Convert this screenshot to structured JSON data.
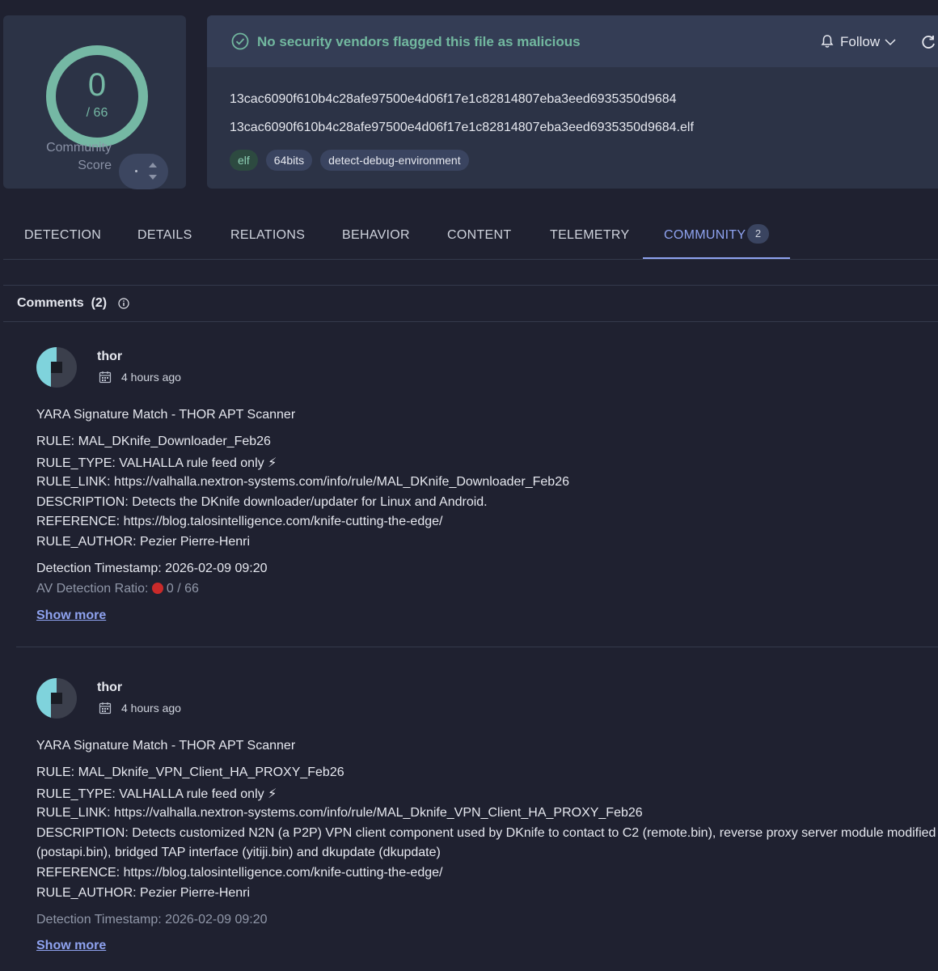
{
  "score": {
    "detections": "0",
    "total": "/ 66",
    "community_label_line1": "Community",
    "community_label_line2": "Score",
    "ring_color": "#75b8a4"
  },
  "header": {
    "status_text": "No security vendors flagged this file as malicious",
    "follow_label": "Follow",
    "hash": "13cac6090f610b4c28afe97500e4d06f17e1c82814807eba3eed6935350d9684",
    "filename": "13cac6090f610b4c28afe97500e4d06f17e1c82814807eba3eed6935350d9684.elf",
    "tags": [
      "elf",
      "64bits",
      "detect-debug-environment"
    ],
    "status_color": "#72b89f"
  },
  "tabs": [
    {
      "label": "DETECTION"
    },
    {
      "label": "DETAILS"
    },
    {
      "label": "RELATIONS"
    },
    {
      "label": "BEHAVIOR"
    },
    {
      "label": "CONTENT"
    },
    {
      "label": "TELEMETRY"
    },
    {
      "label": "COMMUNITY",
      "badge": "2",
      "active": true
    }
  ],
  "comments_section": {
    "title": "Comments  (2)"
  },
  "comments": [
    {
      "author": "thor",
      "time": "4 hours ago",
      "heading": "YARA Signature Match - THOR APT Scanner",
      "rule": "RULE: MAL_DKnife_Downloader_Feb26",
      "rule_type": "RULE_TYPE: VALHALLA rule feed only ⚡",
      "rule_link": "RULE_LINK: https://valhalla.nextron-systems.com/info/rule/MAL_DKnife_Downloader_Feb26",
      "description": "DESCRIPTION: Detects the DKnife downloader/updater for Linux and Android.",
      "reference": "REFERENCE: https://blog.talosintelligence.com/knife-cutting-the-edge/",
      "author_line": "RULE_AUTHOR: Pezier Pierre-Henri",
      "timestamp": "Detection Timestamp: 2026-02-09 09:20",
      "ratio_label": "AV Detection Ratio:",
      "ratio_value": "0 / 66",
      "show_more": "Show more"
    },
    {
      "author": "thor",
      "time": "4 hours ago",
      "heading": "YARA Signature Match - THOR APT Scanner",
      "rule": "RULE: MAL_Dknife_VPN_Client_HA_PROXY_Feb26",
      "rule_type": "RULE_TYPE: VALHALLA rule feed only ⚡",
      "rule_link": "RULE_LINK: https://valhalla.nextron-systems.com/info/rule/MAL_Dknife_VPN_Client_HA_PROXY_Feb26",
      "description": "DESCRIPTION: Detects customized N2N (a P2P) VPN client component used by DKnife to contact to C2 (remote.bin), reverse proxy server module modified",
      "description_cont": "(postapi.bin), bridged TAP interface (yitiji.bin) and dkupdate (dkupdate)",
      "reference": "REFERENCE: https://blog.talosintelligence.com/knife-cutting-the-edge/",
      "author_line": "RULE_AUTHOR: Pezier Pierre-Henri",
      "timestamp": "Detection Timestamp: 2026-02-09 09:20",
      "show_more": "Show more"
    }
  ]
}
